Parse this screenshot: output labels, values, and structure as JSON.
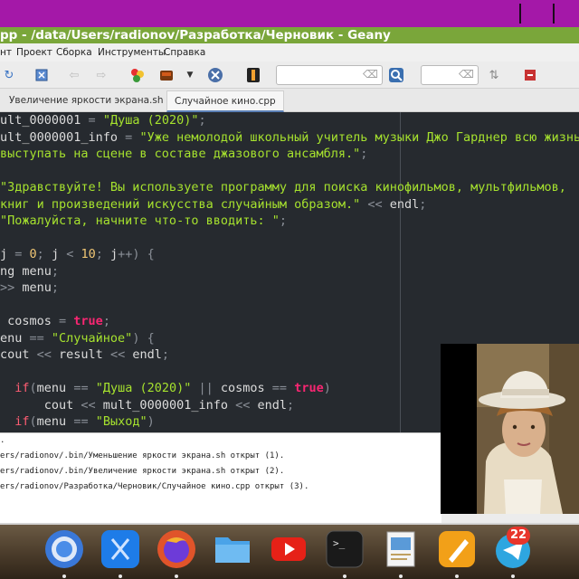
{
  "window": {
    "title": "pp - /data/Users/radionov/Разработка/Черновик - Geany",
    "menu": [
      "нт",
      "Проект",
      "Сборка",
      "Инструменты",
      "Справка"
    ]
  },
  "tabs": [
    {
      "label": "Увеличение яркости экрана.sh"
    },
    {
      "label": "Случайное кино.cpp",
      "active": true
    }
  ],
  "editor": {
    "lines": [
      [
        [
          "ult_0000001 ",
          "p"
        ],
        [
          "= ",
          "op"
        ],
        [
          "\"Душа (2020)\"",
          "str"
        ],
        [
          ";",
          "op"
        ]
      ],
      [
        [
          "ult_0000001_info ",
          "p"
        ],
        [
          "= ",
          "op"
        ],
        [
          "\"Уже немолодой школьный учитель музыки Джо Гарднер всю жизнь",
          "str"
        ]
      ],
      [
        [
          "выступать на сцене в составе джазового ансамбля.\"",
          "str"
        ],
        [
          ";",
          "op"
        ]
      ],
      [],
      [
        [
          "\"Здравствуйте! Вы используете программу для поиска кинофильмов, мультфильмов,",
          "str"
        ]
      ],
      [
        [
          "книг и произведений искусства случайным образом.\"",
          "str"
        ],
        [
          " << ",
          "op"
        ],
        [
          "endl",
          "p"
        ],
        [
          ";",
          "op"
        ]
      ],
      [
        [
          "\"Пожалуйста, начните что-то вводить: \"",
          "str"
        ],
        [
          ";",
          "op"
        ]
      ],
      [],
      [
        [
          "j ",
          "p"
        ],
        [
          "= ",
          "op"
        ],
        [
          "0",
          "num"
        ],
        [
          "; ",
          "op"
        ],
        [
          "j ",
          "p"
        ],
        [
          "< ",
          "op"
        ],
        [
          "10",
          "num"
        ],
        [
          "; ",
          "op"
        ],
        [
          "j",
          "p"
        ],
        [
          "++",
          "op"
        ],
        [
          ") {",
          "op"
        ]
      ],
      [
        [
          "ng menu",
          "p"
        ],
        [
          ";",
          "op"
        ]
      ],
      [
        [
          ">> ",
          "op"
        ],
        [
          "menu",
          "p"
        ],
        [
          ";",
          "op"
        ]
      ],
      [],
      [
        [
          " cosmos ",
          "p"
        ],
        [
          "= ",
          "op"
        ],
        [
          "true",
          "tr"
        ],
        [
          ";",
          "op"
        ]
      ],
      [
        [
          "enu ",
          "p"
        ],
        [
          "== ",
          "op"
        ],
        [
          "\"Случайное\"",
          "str"
        ],
        [
          ") {",
          "op"
        ]
      ],
      [
        [
          "cout ",
          "p"
        ],
        [
          "<< ",
          "op"
        ],
        [
          "result ",
          "p"
        ],
        [
          "<< ",
          "op"
        ],
        [
          "endl",
          "p"
        ],
        [
          ";",
          "op"
        ]
      ],
      [],
      [
        [
          "  ",
          "p"
        ],
        [
          "if",
          "kw"
        ],
        [
          "(",
          "op"
        ],
        [
          "menu ",
          "p"
        ],
        [
          "== ",
          "op"
        ],
        [
          "\"Душа (2020)\"",
          "str"
        ],
        [
          " || ",
          "op"
        ],
        [
          "cosmos ",
          "p"
        ],
        [
          "== ",
          "op"
        ],
        [
          "true",
          "tr"
        ],
        [
          ")",
          "op"
        ]
      ],
      [
        [
          "      cout ",
          "p"
        ],
        [
          "<< ",
          "op"
        ],
        [
          "mult_0000001_info ",
          "p"
        ],
        [
          "<< ",
          "op"
        ],
        [
          "endl",
          "p"
        ],
        [
          ";",
          "op"
        ]
      ],
      [
        [
          "  ",
          "p"
        ],
        [
          "if",
          "kw"
        ],
        [
          "(",
          "op"
        ],
        [
          "menu ",
          "p"
        ],
        [
          "== ",
          "op"
        ],
        [
          "\"Выход\"",
          "str"
        ],
        [
          ")",
          "op"
        ]
      ]
    ]
  },
  "messages": [
    ".",
    "ers/radionov/.bin/Уменьшение яркости экрана.sh открыт (1).",
    "ers/radionov/.bin/Увеличение яркости экрана.sh открыт (2).",
    "ers/radionov/Разработка/Черновик/Случайное кино.cpp открыт (3)."
  ],
  "dock": {
    "badge_count": "22",
    "apps": [
      "chrome-icon",
      "xcode-icon",
      "firefox-icon",
      "finder-folder-icon",
      "youtube-icon",
      "terminal-icon",
      "preview-icon",
      "pages-icon",
      "telegram-icon"
    ]
  },
  "colors": {
    "titlebar": "#7aa63a",
    "editor_bg": "#262a2f",
    "string": "#a6e22e",
    "keyword": "#ff5d73",
    "number": "#f0c674"
  }
}
